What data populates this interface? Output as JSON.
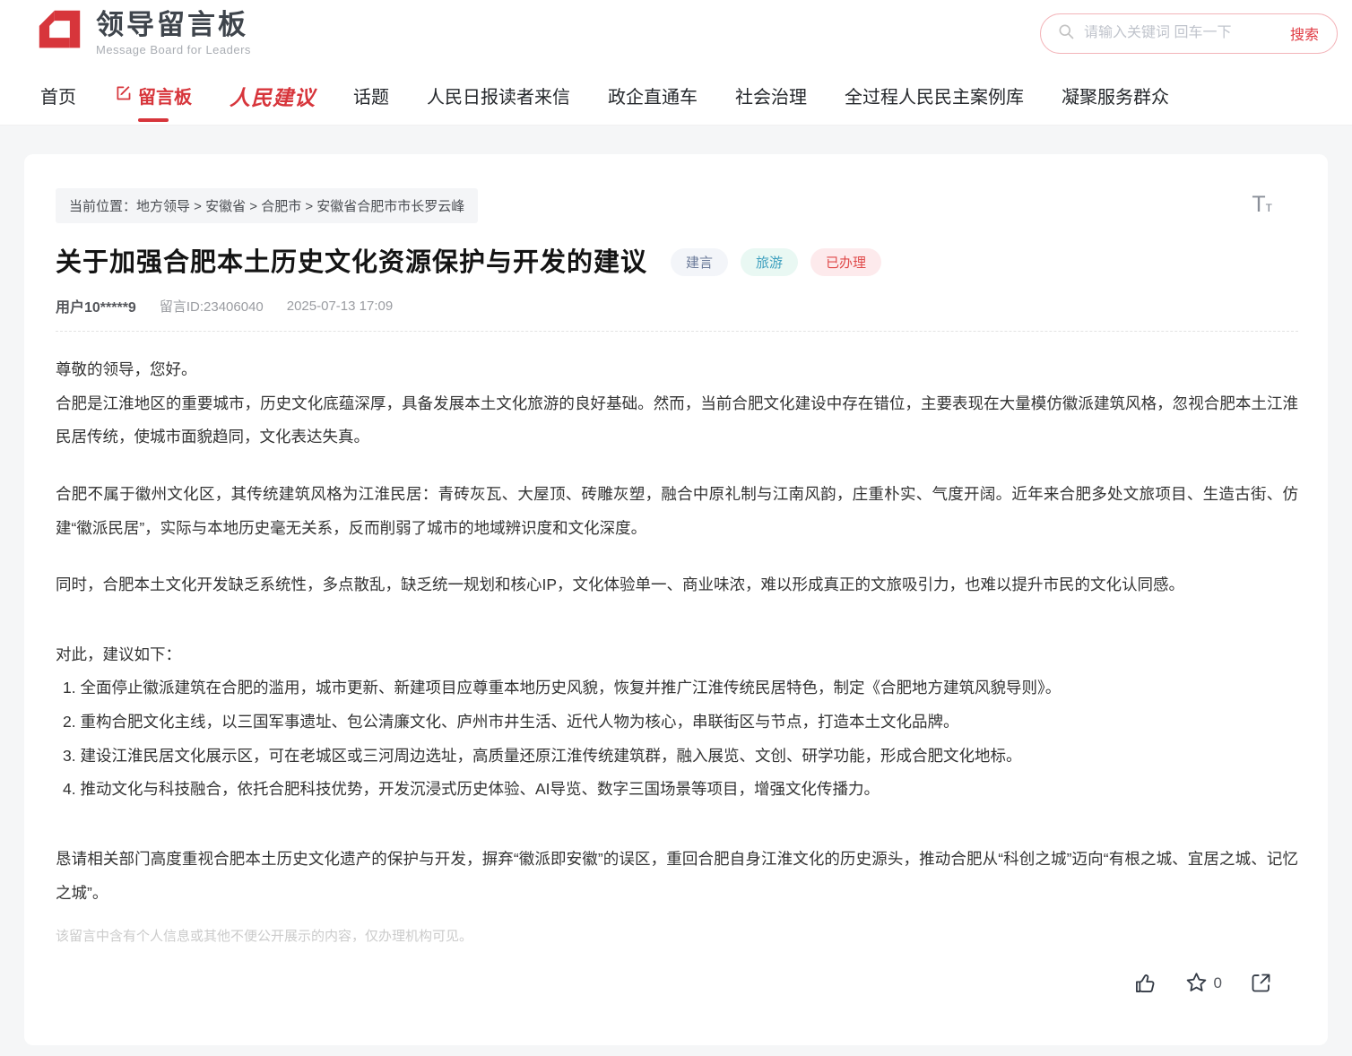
{
  "colors": {
    "accent_red": "#d7353b",
    "search_red": "#e03a42",
    "tag_gray_text": "#6b7a99",
    "tag_teal_text": "#3d9fbe",
    "tag_red_text": "#e04a4a"
  },
  "header": {
    "logo": {
      "title": "领导留言板",
      "subtitle": "Message Board for Leaders"
    },
    "search": {
      "placeholder": "请输入关键词 回车一下",
      "button": "搜索"
    }
  },
  "nav": {
    "items": [
      {
        "label": "首页"
      },
      {
        "label": "留言板"
      },
      {
        "label": "人民建议"
      },
      {
        "label": "话题"
      },
      {
        "label": "人民日报读者来信"
      },
      {
        "label": "政企直通车"
      },
      {
        "label": "社会治理"
      },
      {
        "label": "全过程人民民主案例库"
      },
      {
        "label": "凝聚服务群众"
      }
    ]
  },
  "breadcrumb": {
    "text": "当前位置：地方领导 > 安徽省 > 合肥市 > 安徽省合肥市市长罗云峰"
  },
  "font_size_widget": {
    "large": "T",
    "small": "т"
  },
  "post": {
    "title": "关于加强合肥本土历史文化资源保护与开发的建议",
    "tags": [
      {
        "label": "建言"
      },
      {
        "label": "旅游"
      },
      {
        "label": "已办理"
      }
    ],
    "author": "用户10*****9",
    "message_id": "留言ID:23406040",
    "datetime": "2025-07-13 17:09",
    "paragraphs": [
      "尊敬的领导，您好。",
      "合肥是江淮地区的重要城市，历史文化底蕴深厚，具备发展本土文化旅游的良好基础。然而，当前合肥文化建设中存在错位，主要表现在大量模仿徽派建筑风格，忽视合肥本土江淮民居传统，使城市面貌趋同，文化表达失真。",
      "合肥不属于徽州文化区，其传统建筑风格为江淮民居：青砖灰瓦、大屋顶、砖雕灰塑，融合中原礼制与江南风韵，庄重朴实、气度开阔。近年来合肥多处文旅项目、生造古街、仿建“徽派民居”，实际与本地历史毫无关系，反而削弱了城市的地域辨识度和文化深度。",
      "同时，合肥本土文化开发缺乏系统性，多点散乱，缺乏统一规划和核心IP，文化体验单一、商业味浓，难以形成真正的文旅吸引力，也难以提升市民的文化认同感。",
      "对此，建议如下："
    ],
    "suggestions": [
      "1. 全面停止徽派建筑在合肥的滥用，城市更新、新建项目应尊重本地历史风貌，恢复并推广江淮传统民居特色，制定《合肥地方建筑风貌导则》。",
      "2. 重构合肥文化主线，以三国军事遗址、包公清廉文化、庐州市井生活、近代人物为核心，串联街区与节点，打造本土文化品牌。",
      "3. 建设江淮民居文化展示区，可在老城区或三河周边选址，高质量还原江淮传统建筑群，融入展览、文创、研学功能，形成合肥文化地标。",
      "4. 推动文化与科技融合，依托合肥科技优势，开发沉浸式历史体验、AI导览、数字三国场景等项目，增强文化传播力。"
    ],
    "closing": "恳请相关部门高度重视合肥本土历史文化遗产的保护与开发，摒弃“徽派即安徽”的误区，重回合肥自身江淮文化的历史源头，推动合肥从“科创之城”迈向“有根之城、宜居之城、记忆之城”。",
    "privacy_note": "该留言中含有个人信息或其他不便公开展示的内容，仅办理机构可见。",
    "favorite_count": "0"
  }
}
